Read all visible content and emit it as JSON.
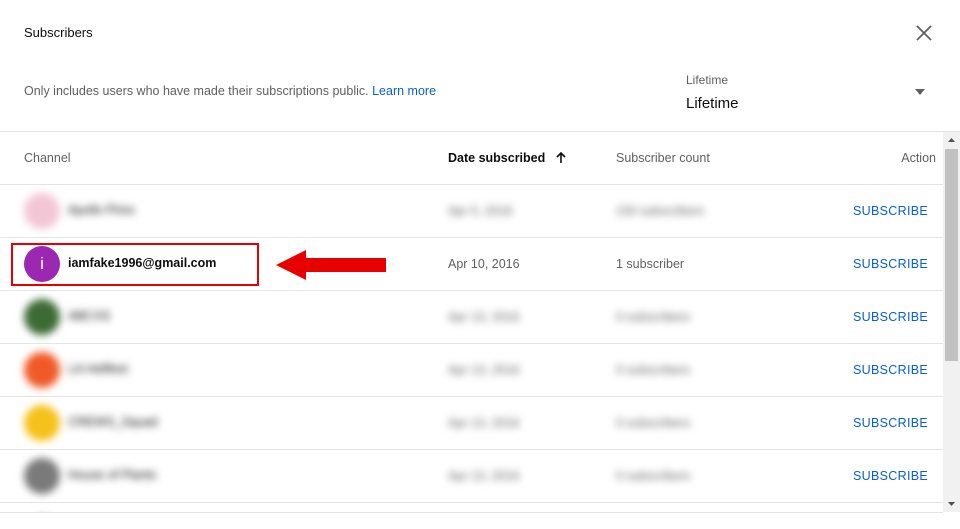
{
  "dialog": {
    "title": "Subscribers",
    "info_text": "Only includes users who have made their subscriptions public.",
    "learn_more": "Learn more",
    "filter": {
      "label": "Lifetime",
      "value": "Lifetime"
    }
  },
  "table": {
    "headers": {
      "channel": "Channel",
      "date_subscribed": "Date subscribed",
      "subscriber_count": "Subscriber count",
      "action": "Action"
    },
    "sorted_by": "date_subscribed",
    "rows": [
      {
        "name": "Apollo Pires",
        "date": "Apr 5, 2016",
        "subscribers": "150 subscribers",
        "action": "SUBSCRIBE",
        "blurred": true,
        "avatar_color": "#f3c6d6"
      },
      {
        "name": "iamfake1996@gmail.com",
        "avatar_letter": "i",
        "date": "Apr 10, 2016",
        "subscribers": "1 subscriber",
        "action": "SUBSCRIBE",
        "blurred": false,
        "avatar_color": "#9c27b0"
      },
      {
        "name": "ABCXS",
        "date": "Apr 13, 2016",
        "subscribers": "0 subscribers",
        "action": "SUBSCRIBE",
        "blurred": true,
        "avatar_color": "#3e6b35"
      },
      {
        "name": "LA Hellfest",
        "date": "Apr 13, 2016",
        "subscribers": "0 subscribers",
        "action": "SUBSCRIBE",
        "blurred": true,
        "avatar_color": "#f05a28"
      },
      {
        "name": "CREWS_Squad",
        "date": "Apr 13, 2016",
        "subscribers": "0 subscribers",
        "action": "SUBSCRIBE",
        "blurred": true,
        "avatar_color": "#f5c21b"
      },
      {
        "name": "House of Plants",
        "date": "Apr 13, 2016",
        "subscribers": "0 subscribers",
        "action": "SUBSCRIBE",
        "blurred": true,
        "avatar_color": "#7a7a7a"
      }
    ]
  },
  "colors": {
    "accent_blue": "#065fd4",
    "highlight_red": "#e60000"
  },
  "icons": {
    "close": "close-icon",
    "dropdown": "caret-down-icon",
    "sort": "arrow-up-icon",
    "annotation": "arrow-left-icon"
  }
}
